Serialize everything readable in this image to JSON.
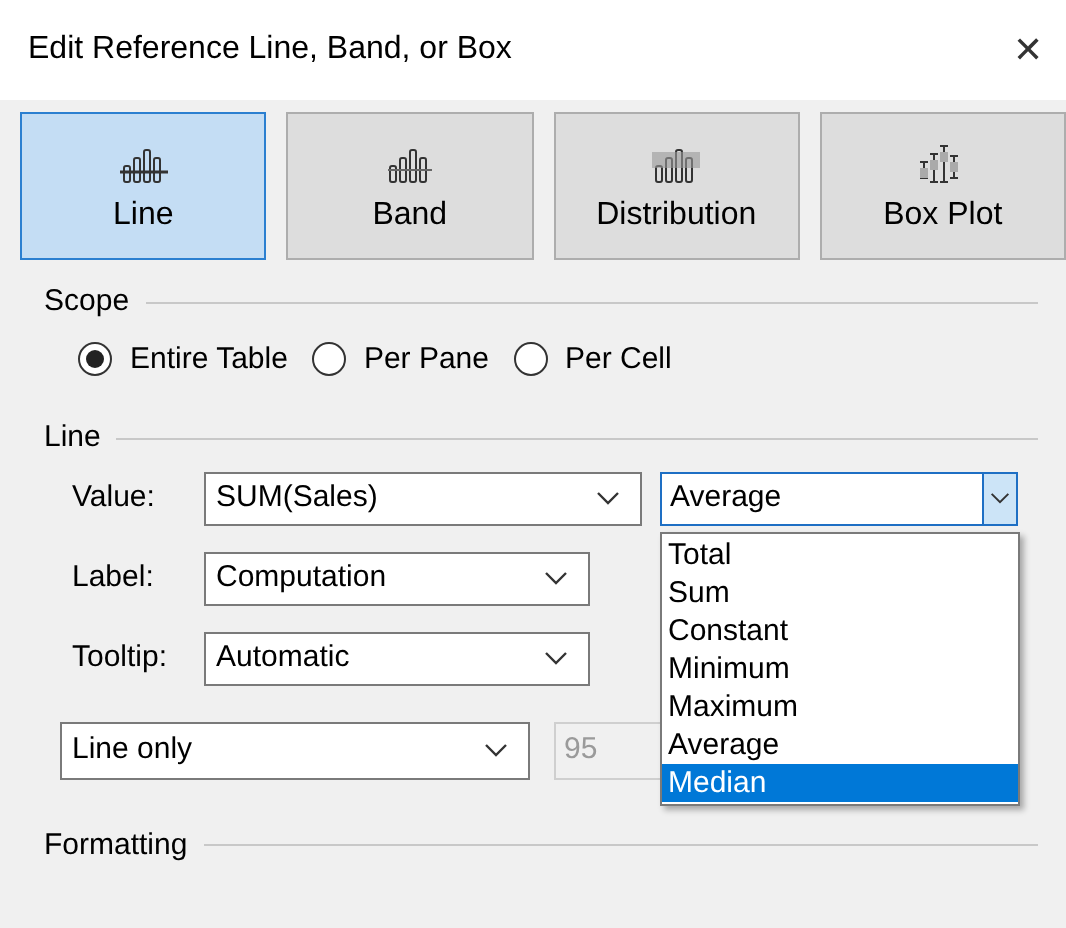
{
  "window": {
    "title": "Edit Reference Line, Band, or Box",
    "close": "✕"
  },
  "tabs": [
    {
      "label": "Line",
      "selected": true,
      "kind": "line"
    },
    {
      "label": "Band",
      "selected": false,
      "kind": "band"
    },
    {
      "label": "Distribution",
      "selected": false,
      "kind": "distribution"
    },
    {
      "label": "Box Plot",
      "selected": false,
      "kind": "box"
    }
  ],
  "scope": {
    "title": "Scope",
    "options": [
      {
        "label": "Entire Table",
        "selected": true
      },
      {
        "label": "Per Pane",
        "selected": false
      },
      {
        "label": "Per Cell",
        "selected": false
      }
    ]
  },
  "line": {
    "title": "Line",
    "value_label": "Value:",
    "value": "SUM(Sales)",
    "aggregation": "Average",
    "label_label": "Label:",
    "label": "Computation",
    "tooltip_label": "Tooltip:",
    "tooltip": "Automatic",
    "style": "Line only",
    "confidence": "95"
  },
  "aggregation_menu": [
    {
      "label": "Total",
      "selected": false
    },
    {
      "label": "Sum",
      "selected": false
    },
    {
      "label": "Constant",
      "selected": false
    },
    {
      "label": "Minimum",
      "selected": false
    },
    {
      "label": "Maximum",
      "selected": false
    },
    {
      "label": "Average",
      "selected": false
    },
    {
      "label": "Median",
      "selected": true
    }
  ],
  "formatting": {
    "title": "Formatting"
  }
}
